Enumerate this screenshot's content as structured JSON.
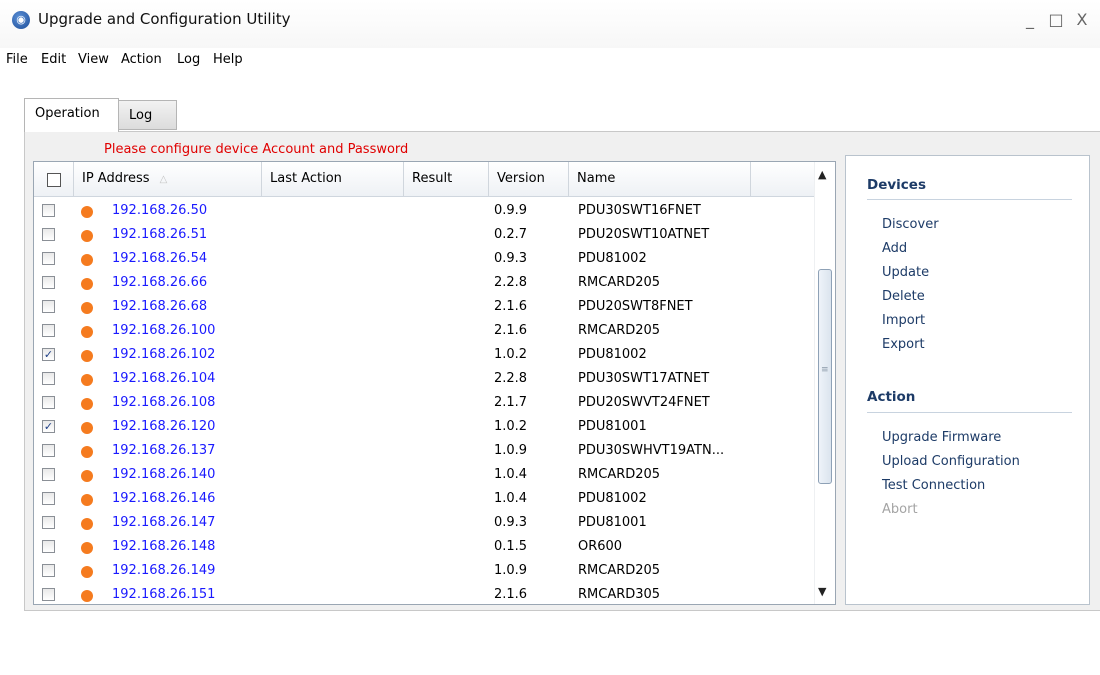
{
  "window": {
    "app_icon": "globe-icon",
    "title": "Upgrade and Configuration Utility",
    "controls": {
      "minimize": "_",
      "maximize": "□",
      "close": "X"
    }
  },
  "menubar": [
    "File",
    "Edit",
    "View",
    "Action",
    "Log",
    "Help"
  ],
  "tabs": {
    "operation": "Operation",
    "log": "Log"
  },
  "notice": "Please configure device Account and Password",
  "grid": {
    "columns": {
      "ip": "IP Address",
      "last_action": "Last Action",
      "result": "Result",
      "version": "Version",
      "name": "Name"
    },
    "rows": [
      {
        "checked": false,
        "ip": "192.168.26.50",
        "version": "0.9.9",
        "name": "PDU30SWT16FNET"
      },
      {
        "checked": false,
        "ip": "192.168.26.51",
        "version": "0.2.7",
        "name": "PDU20SWT10ATNET"
      },
      {
        "checked": false,
        "ip": "192.168.26.54",
        "version": "0.9.3",
        "name": "PDU81002"
      },
      {
        "checked": false,
        "ip": "192.168.26.66",
        "version": "2.2.8",
        "name": "RMCARD205"
      },
      {
        "checked": false,
        "ip": "192.168.26.68",
        "version": "2.1.6",
        "name": "PDU20SWT8FNET"
      },
      {
        "checked": false,
        "ip": "192.168.26.100",
        "version": "2.1.6",
        "name": "RMCARD205"
      },
      {
        "checked": true,
        "ip": "192.168.26.102",
        "version": "1.0.2",
        "name": "PDU81002"
      },
      {
        "checked": false,
        "ip": "192.168.26.104",
        "version": "2.2.8",
        "name": "PDU30SWT17ATNET"
      },
      {
        "checked": false,
        "ip": "192.168.26.108",
        "version": "2.1.7",
        "name": "PDU20SWVT24FNET"
      },
      {
        "checked": true,
        "ip": "192.168.26.120",
        "version": "1.0.2",
        "name": "PDU81001"
      },
      {
        "checked": false,
        "ip": "192.168.26.137",
        "version": "1.0.9",
        "name": "PDU30SWHVT19ATN..."
      },
      {
        "checked": false,
        "ip": "192.168.26.140",
        "version": "1.0.4",
        "name": "RMCARD205"
      },
      {
        "checked": false,
        "ip": "192.168.26.146",
        "version": "1.0.4",
        "name": "PDU81002"
      },
      {
        "checked": false,
        "ip": "192.168.26.147",
        "version": "0.9.3",
        "name": "PDU81001"
      },
      {
        "checked": false,
        "ip": "192.168.26.148",
        "version": "0.1.5",
        "name": "OR600"
      },
      {
        "checked": false,
        "ip": "192.168.26.149",
        "version": "1.0.9",
        "name": "RMCARD205"
      },
      {
        "checked": false,
        "ip": "192.168.26.151",
        "version": "2.1.6",
        "name": "RMCARD305"
      }
    ]
  },
  "side_panel": {
    "devices_heading": "Devices",
    "devices": [
      "Discover",
      "Add",
      "Update",
      "Delete",
      "Import",
      "Export"
    ],
    "action_heading": "Action",
    "actions": [
      {
        "label": "Upgrade Firmware",
        "enabled": true
      },
      {
        "label": "Upload Configuration",
        "enabled": true
      },
      {
        "label": "Test Connection",
        "enabled": true
      },
      {
        "label": "Abort",
        "enabled": false
      }
    ]
  },
  "colors": {
    "status_dot": "#f57b1f",
    "ip_link": "#1a1aff",
    "notice": "#e00000",
    "panel_link": "#1d3b67"
  }
}
